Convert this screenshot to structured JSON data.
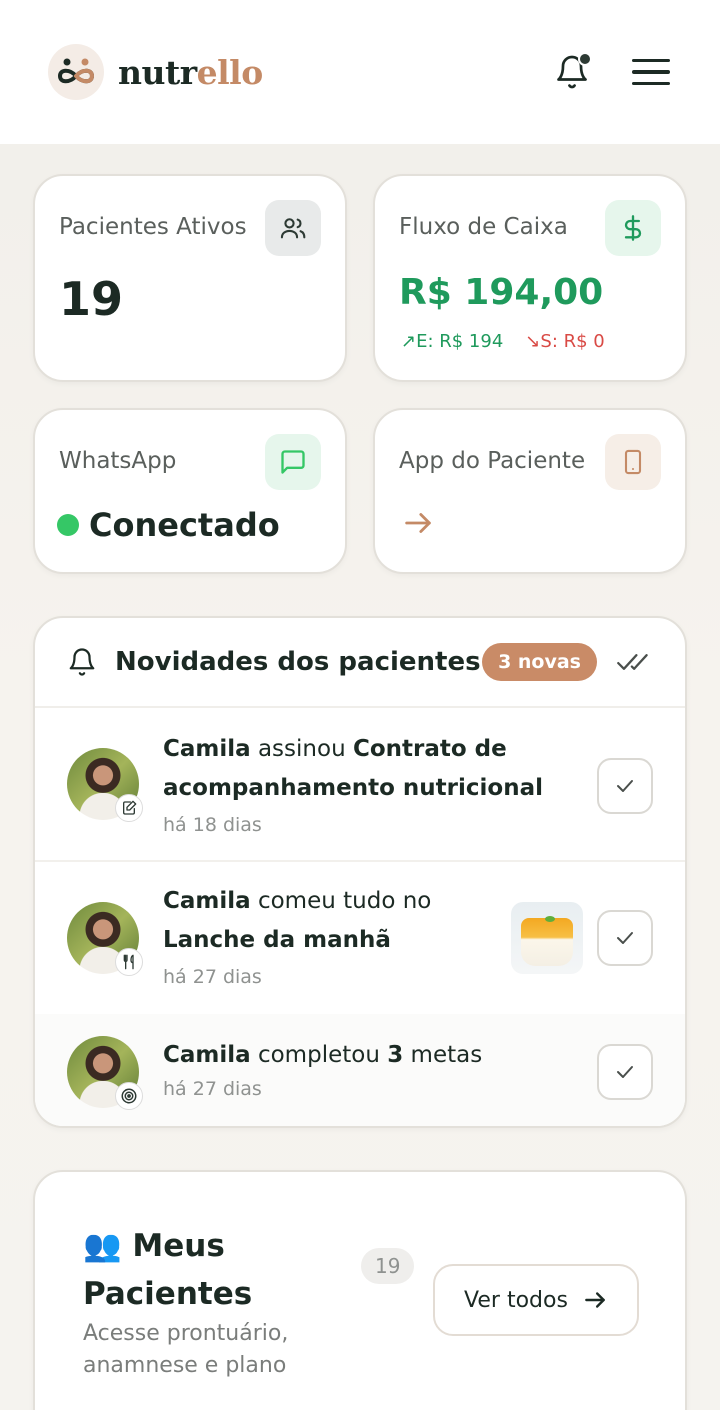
{
  "header": {
    "brand_part1": "nutr",
    "brand_part2": "ello",
    "bell_icon": "bell-icon",
    "menu_icon": "hamburger-menu-icon"
  },
  "stats": {
    "patients": {
      "label": "Pacientes Ativos",
      "value": "19",
      "icon": "users-icon"
    },
    "cashflow": {
      "label": "Fluxo de Caixa",
      "value": "R$ 194,00",
      "in_label": "E: R$ 194",
      "out_label": "S: R$ 0",
      "icon": "dollar-icon"
    },
    "whatsapp": {
      "label": "WhatsApp",
      "status": "Conectado",
      "icon": "chat-icon"
    },
    "patient_app": {
      "label": "App do Paciente",
      "icon": "smartphone-icon"
    }
  },
  "news": {
    "title": "Novidades dos pacientes",
    "badge": "3 novas",
    "items": [
      {
        "name": "Camila",
        "verb": " assinou ",
        "object_line1": "Contrato de",
        "object_line2": "acompanhamento nutricional",
        "time": "há 18 dias",
        "badge_icon": "sign-document-icon"
      },
      {
        "name": "Camila",
        "verb": " comeu tudo no",
        "object_line2": "Lanche da manhã",
        "time": "há 27 dias",
        "badge_icon": "utensils-icon"
      },
      {
        "name": "Camila",
        "verb": " completou ",
        "count": "3",
        "suffix": " metas",
        "time": "há 27 dias",
        "badge_icon": "target-icon"
      }
    ]
  },
  "patients_card": {
    "emoji": "👥",
    "title_line1": "Meus",
    "title_line2": "Pacientes",
    "subtitle": "Acesse prontuário, anamnese e plano",
    "count": "19",
    "button_label": "Ver todos"
  },
  "colors": {
    "accent": "#c98b67",
    "money_green": "#1f9a5c",
    "outflow_red": "#d94a45",
    "status_green": "#35c766"
  }
}
